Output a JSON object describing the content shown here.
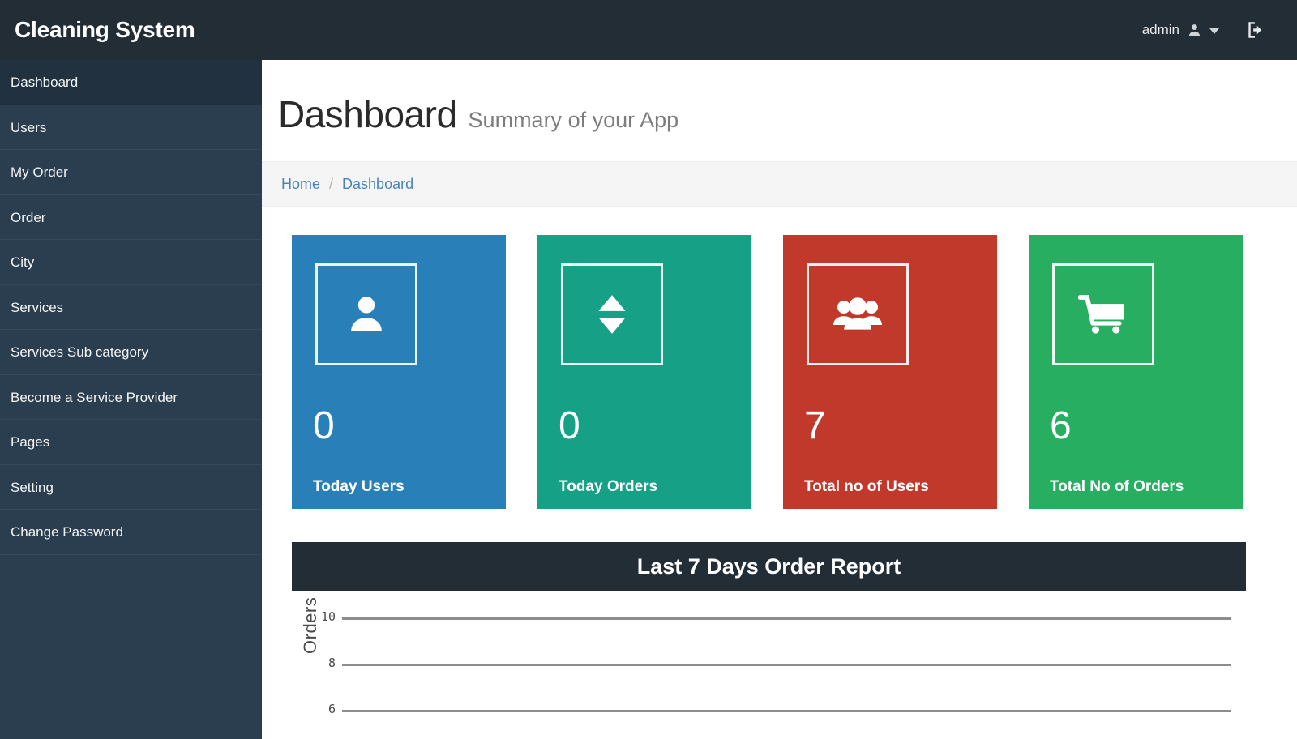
{
  "header": {
    "brand": "Cleaning System",
    "username": "admin",
    "user_icon": "user-icon",
    "caret_icon": "chevron-down-icon",
    "logout_icon": "logout-icon"
  },
  "sidebar": {
    "items": [
      {
        "label": "Dashboard",
        "active": true
      },
      {
        "label": "Users",
        "active": false
      },
      {
        "label": "My Order",
        "active": false
      },
      {
        "label": "Order",
        "active": false
      },
      {
        "label": "City",
        "active": false
      },
      {
        "label": "Services",
        "active": false
      },
      {
        "label": "Services Sub category",
        "active": false
      },
      {
        "label": "Become a Service Provider",
        "active": false
      },
      {
        "label": "Pages",
        "active": false
      },
      {
        "label": "Setting",
        "active": false
      },
      {
        "label": "Change Password",
        "active": false
      }
    ]
  },
  "page": {
    "title": "Dashboard",
    "subtitle": "Summary of your App"
  },
  "breadcrumb": {
    "home": "Home",
    "separator": "/",
    "current": "Dashboard"
  },
  "cards": [
    {
      "value": "0",
      "label": "Today Users",
      "color": "#2980b9",
      "icon": "user-icon"
    },
    {
      "value": "0",
      "label": "Today Orders",
      "color": "#16a085",
      "icon": "sort-arrows-icon"
    },
    {
      "value": "7",
      "label": "Total no of Users",
      "color": "#c0392b",
      "icon": "users-group-icon"
    },
    {
      "value": "6",
      "label": "Total No of Orders",
      "color": "#27ae60",
      "icon": "shopping-cart-icon"
    }
  ],
  "chart_data": {
    "type": "line",
    "title": "Last 7 Days Order Report",
    "xlabel": "",
    "ylabel": "Orders",
    "ylim": [
      0,
      10
    ],
    "yticks": [
      10,
      8,
      6
    ],
    "grid": true,
    "categories": [],
    "values": [],
    "note": "Chart body is cut off by the viewport; only the top gridlines at 10, 8 and 6 are visible."
  }
}
